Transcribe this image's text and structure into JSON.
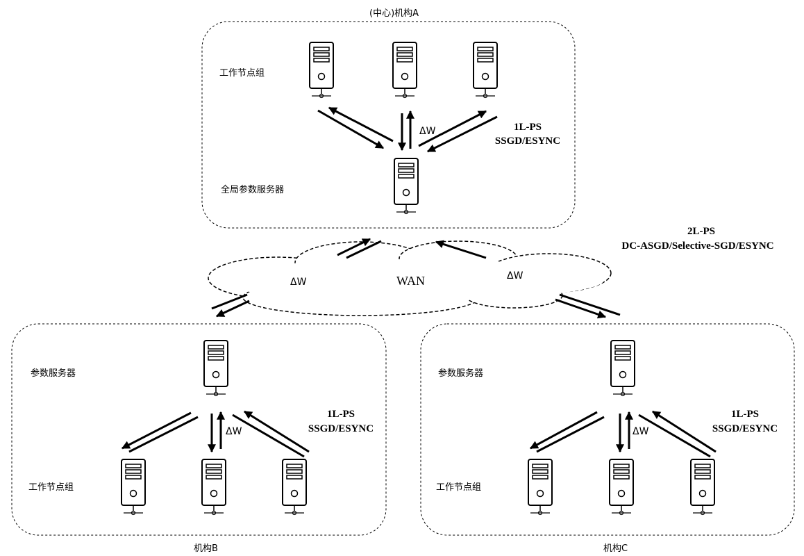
{
  "org_a": {
    "title": "(中心)机构A",
    "worker_group_label": "工作节点组",
    "ps_label": "全局参数服务器",
    "protocol_line1": "1L-PS",
    "protocol_line2": "SSGD/ESYNC",
    "delta": "ΔW"
  },
  "wan": {
    "label": "WAN",
    "delta_left": "ΔW",
    "delta_right": "ΔW",
    "protocol_line1": "2L-PS",
    "protocol_line2": "DC-ASGD/Selective-SGD/ESYNC"
  },
  "org_b": {
    "title": "机构B",
    "ps_label": "参数服务器",
    "worker_group_label": "工作节点组",
    "protocol_line1": "1L-PS",
    "protocol_line2": "SSGD/ESYNC",
    "delta": "ΔW"
  },
  "org_c": {
    "title": "机构C",
    "ps_label": "参数服务器",
    "worker_group_label": "工作节点组",
    "protocol_line1": "1L-PS",
    "protocol_line2": "SSGD/ESYNC",
    "delta": "ΔW"
  },
  "icons": {
    "server": "server-icon",
    "cloud": "cloud-icon",
    "arrow": "arrow-icon"
  }
}
